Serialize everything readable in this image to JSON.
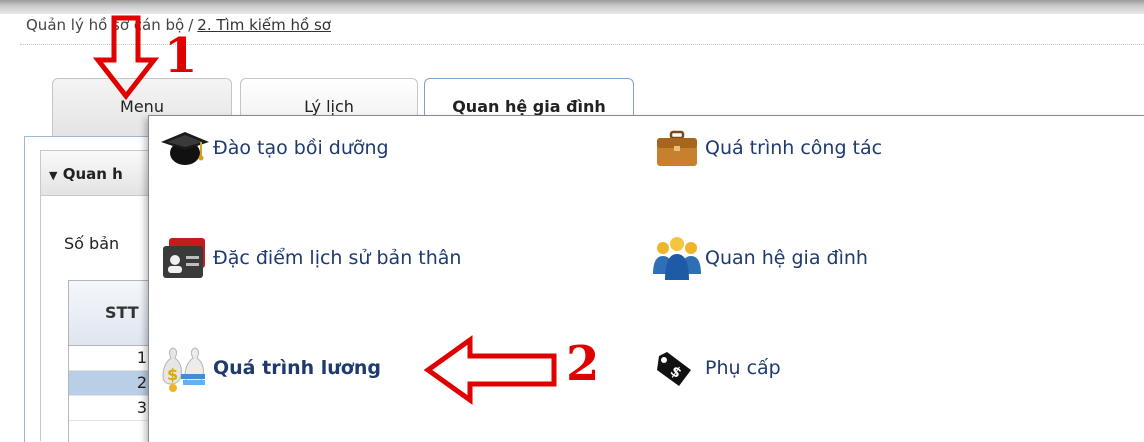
{
  "breadcrumb": {
    "root": "Quản lý hồ sơ cán bộ",
    "separator": "/",
    "current": "2. Tìm kiếm hồ sơ"
  },
  "tabs": [
    {
      "label": "Menu"
    },
    {
      "label": "Lý lịch"
    },
    {
      "label": "Quan hệ gia đình"
    }
  ],
  "section": {
    "title": "Quan h",
    "records_label": "Số bản",
    "grid_header": "STT",
    "rows": [
      "1",
      "2",
      "3"
    ],
    "selected_row": "2"
  },
  "menu": {
    "items": [
      {
        "label": "Đào tạo bồi dưỡng",
        "icon": "graduation-cap-icon"
      },
      {
        "label": "Quá trình công tác",
        "icon": "briefcase-icon"
      },
      {
        "label": "Đặc điểm lịch sử bản thân",
        "icon": "id-card-icon"
      },
      {
        "label": "Quan hệ gia đình",
        "icon": "people-group-icon"
      },
      {
        "label": "Quá trình lương",
        "icon": "money-bags-icon"
      },
      {
        "label": "Phụ cấp",
        "icon": "price-tag-icon"
      }
    ]
  },
  "annotations": {
    "step1": "1",
    "step2": "2",
    "color": "#e00000"
  },
  "colors": {
    "menu_text": "#1e3a6e",
    "selected_row": "#b9cfe8",
    "active_tab_border": "#7da2ce"
  }
}
